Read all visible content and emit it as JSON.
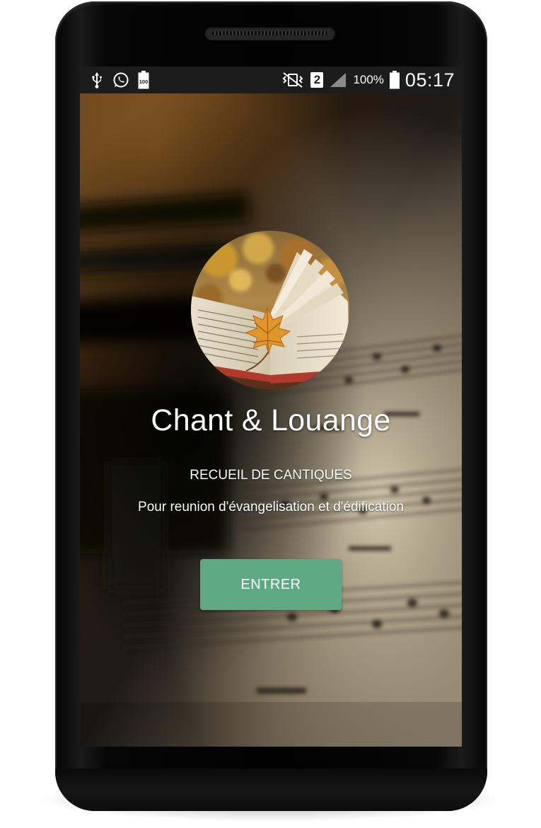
{
  "statusbar": {
    "icons_left": [
      "usb-icon",
      "whatsapp-icon",
      "battery-100-icon"
    ],
    "battery_small_label": "100",
    "icons_right": [
      "vibrate-icon",
      "sim-2-icon",
      "signal-icon",
      "battery-icon"
    ],
    "sim_number": "2",
    "battery_percent": "100%",
    "time": "05:17"
  },
  "app": {
    "title": "Chant & Louange",
    "subtitle": "RECUEIL DE CANTIQUES",
    "tagline": "Pour reunion d'évangelisation et d'édification",
    "enter_label": "ENTRER"
  },
  "colors": {
    "button": "#5faa83",
    "statusbar": "#1c1c1c",
    "text": "#ffffff"
  }
}
